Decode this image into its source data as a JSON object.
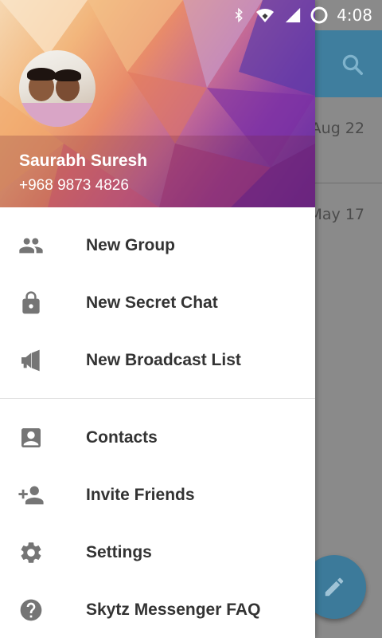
{
  "status_bar": {
    "time": "4:08"
  },
  "background": {
    "dates": [
      "Aug 22",
      "May 17"
    ]
  },
  "drawer": {
    "profile": {
      "name": "Saurabh Suresh",
      "phone": "+968 9873 4826"
    },
    "items": [
      {
        "label": "New Group",
        "icon": "group-icon"
      },
      {
        "label": "New Secret Chat",
        "icon": "lock-icon"
      },
      {
        "label": "New Broadcast List",
        "icon": "megaphone-icon"
      },
      {
        "label": "Contacts",
        "icon": "contact-icon"
      },
      {
        "label": "Invite Friends",
        "icon": "add-person-icon"
      },
      {
        "label": "Settings",
        "icon": "gear-icon"
      },
      {
        "label": "Skytz Messenger FAQ",
        "icon": "help-icon"
      }
    ]
  },
  "colors": {
    "toolbar": "#3f7e9e",
    "fab": "#3c7a9a",
    "menu_icon": "#757575",
    "menu_text": "#333333"
  }
}
